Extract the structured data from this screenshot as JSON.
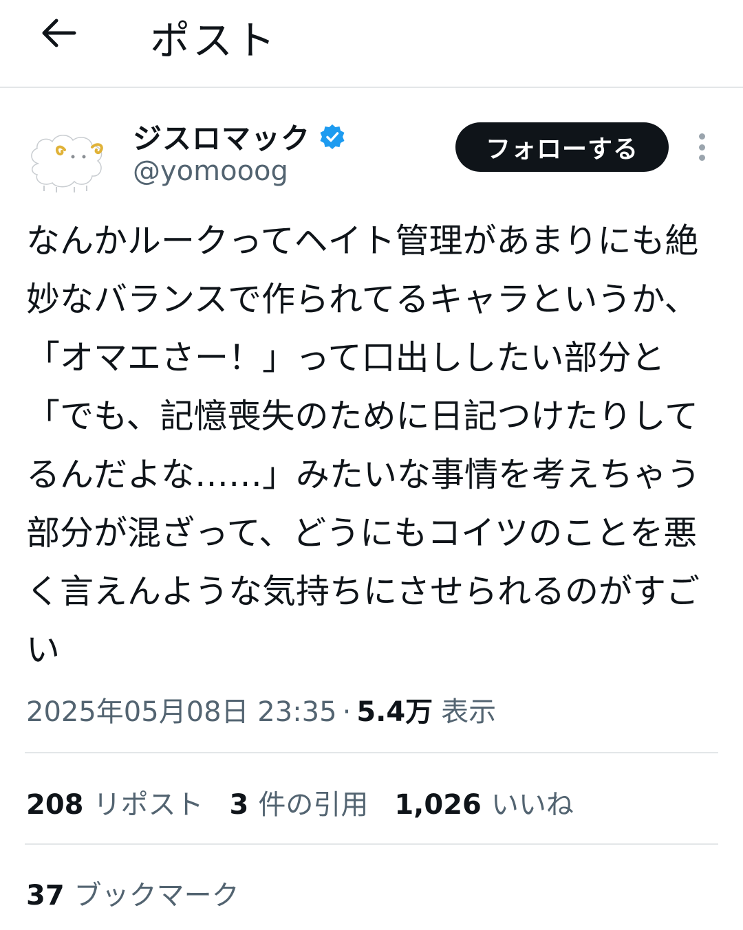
{
  "header": {
    "title": "ポスト",
    "back_icon": "arrow-left-icon"
  },
  "author": {
    "display_name": "ジスロマック",
    "handle": "@yomooog",
    "verified": true,
    "verified_color": "#1d9bf0",
    "follow_label": "フォローする",
    "more_icon": "more-vertical-icon"
  },
  "post": {
    "text": "なんかルークってヘイト管理があまりにも絶妙なバランスで作られてるキャラというか、「オマエさー！」って口出ししたい部分と「でも、記憶喪失のために日記つけたりしてるんだよな……」みたいな事情を考えちゃう部分が混ざって、どうにもコイツのことを悪く言えんような気持ちにさせられるのがすごい",
    "timestamp": "2025年05月08日 23:35",
    "separator": "·",
    "views": "5.4万",
    "views_label": "表示"
  },
  "stats": {
    "reposts": "208",
    "reposts_label": "リポスト",
    "quotes": "3",
    "quotes_label": "件の引用",
    "likes": "1,026",
    "likes_label": "いいね",
    "bookmarks": "37",
    "bookmarks_label": "ブックマーク"
  }
}
